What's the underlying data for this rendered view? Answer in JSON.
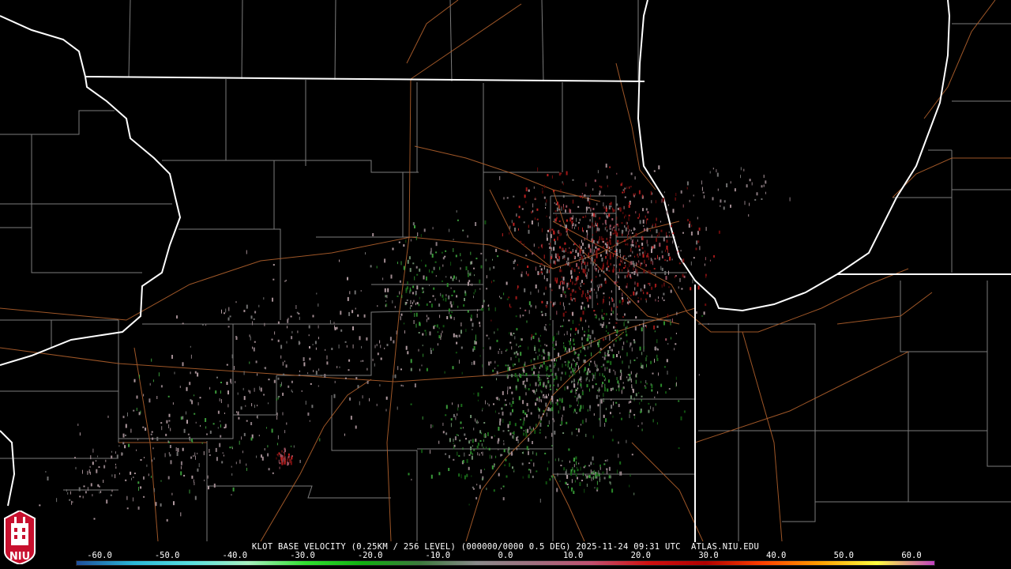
{
  "caption": "KLOT BASE VELOCITY (0.25KM / 256 LEVEL) (000000/0000 0.5 DEG) 2025-11-24 09:31 UTC  ATLAS.NIU.EDU",
  "colorbar": {
    "labels": [
      "-60.0",
      "-50.0",
      "-40.0",
      "-30.0",
      "-20.0",
      "-10.0",
      "0.0",
      "10.0",
      "20.0",
      "30.0",
      "40.0",
      "50.0",
      "60.0"
    ],
    "colors": [
      "#1f4f9c",
      "#2ab8d8",
      "#58e0e0",
      "#a8f0c0",
      "#30e030",
      "#10b010",
      "#3c7a3c",
      "#8a8a8a",
      "#a07080",
      "#c05070",
      "#d01010",
      "#b00000",
      "#ff4000",
      "#ffa000",
      "#ffff40",
      "#c040c0"
    ]
  },
  "logo": {
    "text": "NIU"
  }
}
